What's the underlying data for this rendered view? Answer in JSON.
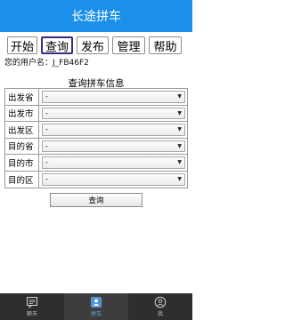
{
  "header": {
    "title": "长途拼车"
  },
  "nav": {
    "buttons": [
      {
        "label": "开始"
      },
      {
        "label": "查询"
      },
      {
        "label": "发布"
      },
      {
        "label": "管理"
      },
      {
        "label": "帮助"
      }
    ],
    "active": "查询"
  },
  "user": {
    "username_line": "您的用户名：J_FB46F2"
  },
  "form": {
    "title": "查询拼车信息",
    "fields": [
      {
        "label": "出发省",
        "value": "-"
      },
      {
        "label": "出发市",
        "value": "-"
      },
      {
        "label": "出发区",
        "value": "-"
      },
      {
        "label": "目的省",
        "value": "-"
      },
      {
        "label": "目的市",
        "value": "-"
      },
      {
        "label": "目的区",
        "value": "-"
      }
    ],
    "submit_label": "查询"
  },
  "tabbar": {
    "tabs": [
      {
        "label": "聊天",
        "icon": "chat-icon"
      },
      {
        "label": "拼车",
        "icon": "user-card-icon"
      },
      {
        "label": "我",
        "icon": "person-icon"
      }
    ],
    "active_index": 1
  },
  "colors": {
    "header_bg": "#1a90e8",
    "tabbar_bg": "#2e2e2e",
    "active_tab_accent": "#6aa8e6"
  }
}
